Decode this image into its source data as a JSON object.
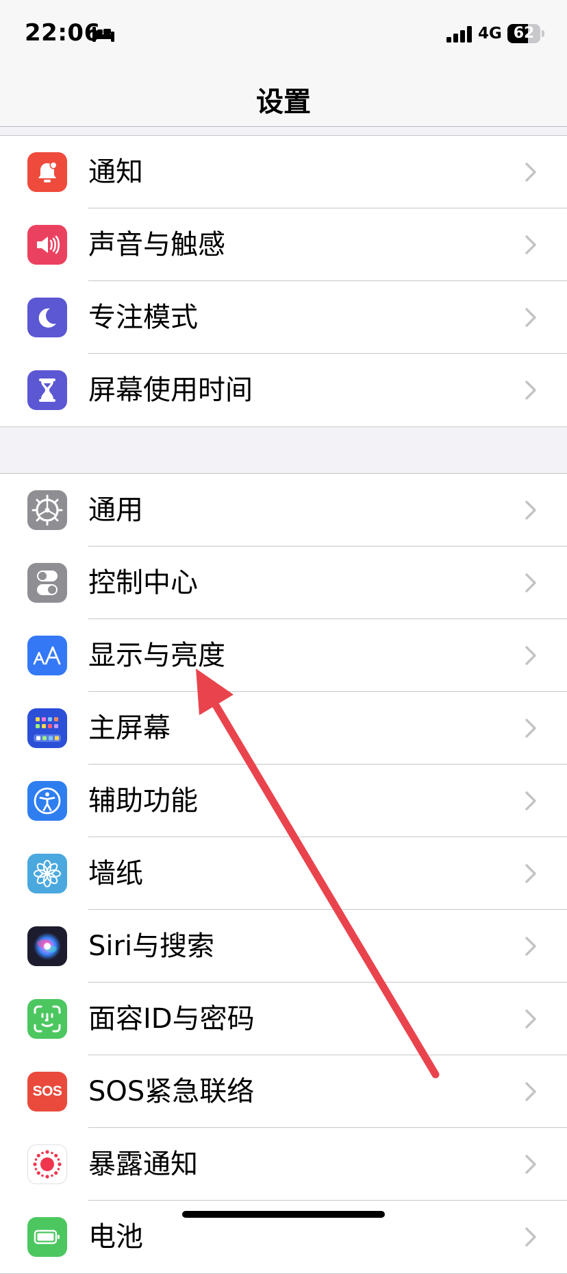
{
  "status_bar": {
    "time": "22:06",
    "network": "4G",
    "battery": "62",
    "battery_level": 0.62
  },
  "nav": {
    "title": "设置"
  },
  "groups": [
    {
      "items": [
        {
          "label": "通知",
          "icon": "notification-bell-icon",
          "color": "#ee4b3d"
        },
        {
          "label": "声音与触感",
          "icon": "speaker-icon",
          "color": "#eb4160"
        },
        {
          "label": "专注模式",
          "icon": "moon-icon",
          "color": "#5c57d2"
        },
        {
          "label": "屏幕使用时间",
          "icon": "hourglass-icon",
          "color": "#5c57d2"
        }
      ]
    },
    {
      "items": [
        {
          "label": "通用",
          "icon": "gear-icon",
          "color": "#8e8e93"
        },
        {
          "label": "控制中心",
          "icon": "toggle-switches-icon",
          "color": "#8e8e93"
        },
        {
          "label": "显示与亮度",
          "icon": "text-size-aa-icon",
          "color": "#3478f6"
        },
        {
          "label": "主屏幕",
          "icon": "home-screen-grid-icon",
          "color": "#2c4fd8"
        },
        {
          "label": "辅助功能",
          "icon": "accessibility-icon",
          "color": "#2f7ef0"
        },
        {
          "label": "墙纸",
          "icon": "flower-icon",
          "color": "#4aa8de"
        },
        {
          "label": "Siri与搜索",
          "icon": "siri-orb-icon",
          "color": "#1c1c2e"
        },
        {
          "label": "面容ID与密码",
          "icon": "face-id-icon",
          "color": "#4cc760"
        },
        {
          "label": "SOS紧急联络",
          "icon": "sos-icon",
          "color": "#e94a3c",
          "icon_text": "SOS"
        },
        {
          "label": "暴露通知",
          "icon": "exposure-dots-icon",
          "color": "#ffffff"
        },
        {
          "label": "电池",
          "icon": "battery-icon",
          "color": "#4cc760"
        }
      ]
    }
  ]
}
